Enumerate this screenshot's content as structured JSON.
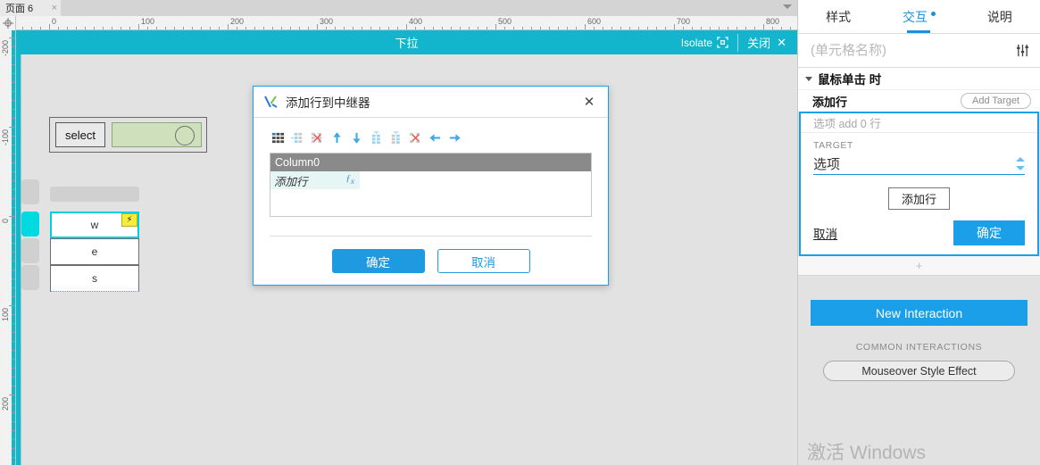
{
  "tab_bar": {
    "page_tab_label": "页面 6",
    "close_glyph": "×",
    "dropdown_icon": "chevron-down-icon"
  },
  "ruler": {
    "horizontal_labels": [
      "0",
      "100",
      "200",
      "300",
      "400",
      "500",
      "600",
      "700",
      "800"
    ],
    "vertical_labels": [
      "-200",
      "-100",
      "0",
      "100",
      "200"
    ],
    "origin_icon": "crosshair-icon"
  },
  "isolate_bar": {
    "title": "下拉",
    "isolate_label": "Isolate",
    "isolate_icon": "isolate-icon",
    "close_label": "关闭",
    "close_glyph": "✕",
    "color": "#12b5cb"
  },
  "canvas": {
    "select_widget": {
      "label": "select",
      "green_fill": "#cfe0bc",
      "circle_icon": "circle-icon"
    },
    "repeater_rows": [
      {
        "text": "w",
        "selected": true,
        "badge_icon": "lightning-bolt-icon"
      },
      {
        "text": "e",
        "selected": false
      },
      {
        "text": "s",
        "selected": false
      }
    ]
  },
  "dialog": {
    "title": "添加行到中继器",
    "logo_icon": "axure-logo-icon",
    "close_icon": "close-icon",
    "toolbar_icons": [
      "add-column-icon",
      "insert-column-icon",
      "delete-column-icon",
      "move-up-icon",
      "move-down-icon",
      "add-row-icon",
      "insert-row-icon",
      "delete-row-icon",
      "move-left-icon",
      "move-right-icon"
    ],
    "grid": {
      "columns": [
        "Column0"
      ],
      "rows": [
        {
          "cell": "添加行",
          "fx_icon": "fx-icon"
        }
      ]
    },
    "ok_label": "确定",
    "cancel_label": "取消"
  },
  "right_panel": {
    "tabs": [
      {
        "label": "样式",
        "active": false,
        "dot": false
      },
      {
        "label": "交互",
        "active": true,
        "dot": true
      },
      {
        "label": "说明",
        "active": false,
        "dot": false
      }
    ],
    "cell_name_placeholder": "(单元格名称)",
    "cell_name_value": "",
    "sliders_icon": "sliders-icon",
    "event": {
      "title": "鼠标单击 时",
      "collapse_icon": "triangle-down-icon"
    },
    "action": {
      "title": "添加行",
      "add_target_label": "Add Target"
    },
    "target_card": {
      "summary": "选项 add 0 行",
      "label": "TARGET",
      "selected_value": "选项",
      "spinner_icon": "stepper-icon",
      "add_row_button": "添加行",
      "cancel_label": "取消",
      "ok_label": "确定"
    },
    "plus_strip_glyph": "+",
    "new_interaction_label": "New Interaction",
    "common_interactions_label": "COMMON INTERACTIONS",
    "mouseover_style_label": "Mouseover Style Effect",
    "watermark": "激活 Windows",
    "accent_color": "#1b9fe8"
  }
}
